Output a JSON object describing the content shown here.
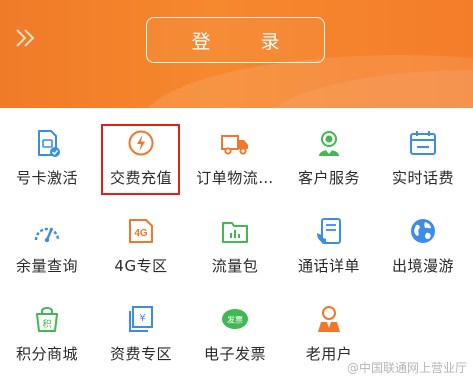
{
  "header": {
    "login_label": "登 录"
  },
  "grid": {
    "row1": [
      {
        "label": "号卡激活"
      },
      {
        "label": "交费充值"
      },
      {
        "label": "订单物流…"
      },
      {
        "label": "客户服务"
      },
      {
        "label": "实时话费"
      }
    ],
    "row2": [
      {
        "label": "余量查询"
      },
      {
        "label": "4G专区",
        "icon_text": "4G"
      },
      {
        "label": "流量包"
      },
      {
        "label": "通话详单"
      },
      {
        "label": "出境漫游"
      }
    ],
    "row3": [
      {
        "label": "积分商城",
        "icon_text": "积"
      },
      {
        "label": "资费专区",
        "icon_text": "¥"
      },
      {
        "label": "电子发票",
        "icon_text": "发票"
      },
      {
        "label": "老用户"
      }
    ]
  },
  "watermark": "@中国联通网上营业厅",
  "colors": {
    "brand_orange": "#f47d2a",
    "icon_blue": "#3a8ee6",
    "icon_orange": "#f0772b",
    "icon_green": "#3fb950",
    "highlight_red": "#e0201b"
  }
}
